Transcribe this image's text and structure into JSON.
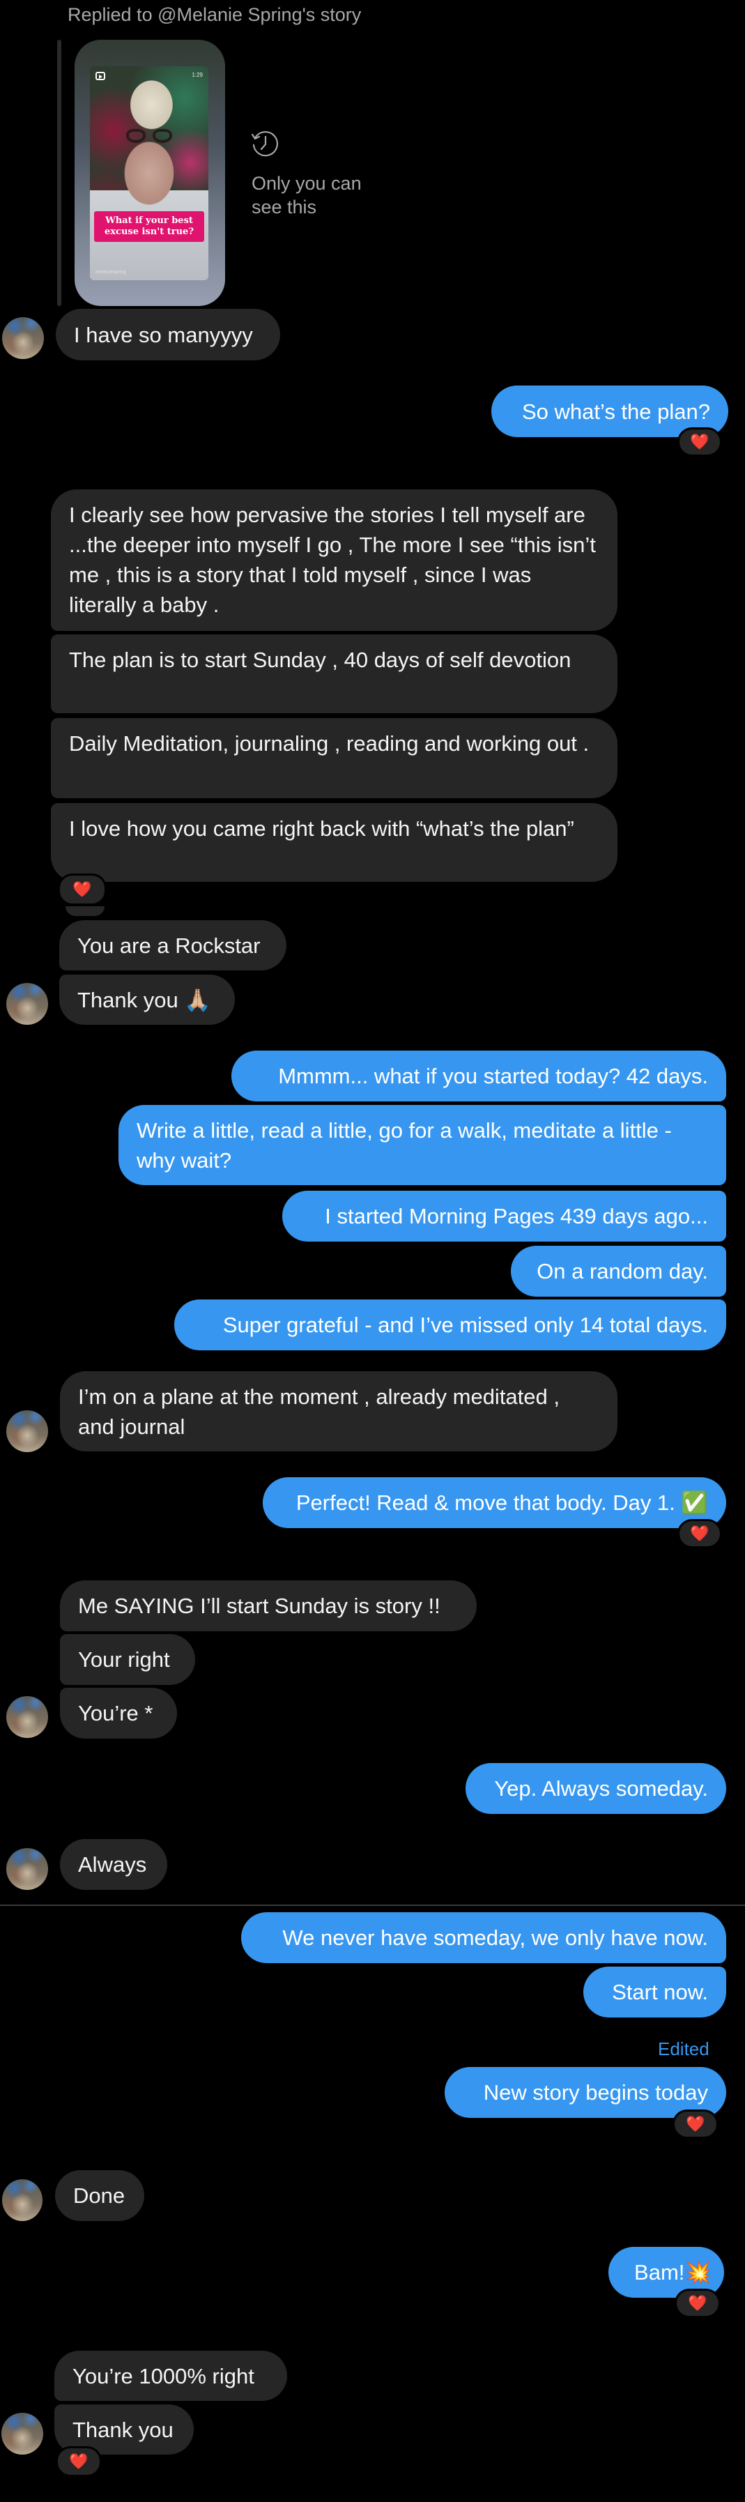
{
  "reply_header": {
    "label": "Replied to @Melanie Spring's story",
    "story": {
      "caption": "What if your best excuse isn't true?",
      "duration": "1:29",
      "handle": "melaniespring",
      "media_type_icon": "reels-icon"
    },
    "visibility_icon": "history-clock-icon",
    "visibility_note": "Only you can see this"
  },
  "colors": {
    "sent_bubble": "#3797f0",
    "received_bubble": "#262626",
    "background": "#000000",
    "edited_label": "#3797f0"
  },
  "messages": [
    {
      "id": "m1",
      "from": "them",
      "text": "I have so manyyyy"
    },
    {
      "id": "m2",
      "from": "me",
      "text": "So what’s the plan?",
      "reaction": "❤️"
    },
    {
      "id": "m3",
      "from": "them",
      "text": "I clearly see how pervasive the stories I tell myself are ...the deeper into myself I go , The more I see “this isn’t me , this is a story that I told myself , since I was literally a baby ."
    },
    {
      "id": "m4",
      "from": "them",
      "text": "The plan is to start Sunday , 40 days of self devotion"
    },
    {
      "id": "m5",
      "from": "them",
      "text": "Daily Meditation, journaling , reading and working out ."
    },
    {
      "id": "m6",
      "from": "them",
      "text": "I love how you came right back with “what’s the plan”",
      "reaction": "❤️"
    },
    {
      "id": "m7",
      "from": "them",
      "text": "You are a Rockstar"
    },
    {
      "id": "m8",
      "from": "them",
      "text": "Thank you 🙏🏼"
    },
    {
      "id": "m9",
      "from": "me",
      "text": "Mmmm... what if you started today? 42 days."
    },
    {
      "id": "m10",
      "from": "me",
      "text": "Write a little, read a little, go for a walk, meditate a little - why wait?"
    },
    {
      "id": "m11",
      "from": "me",
      "text": "I started Morning Pages 439 days ago..."
    },
    {
      "id": "m12",
      "from": "me",
      "text": "On a random day."
    },
    {
      "id": "m13",
      "from": "me",
      "text": "Super grateful - and I’ve missed only 14 total days."
    },
    {
      "id": "m14",
      "from": "them",
      "text": "I’m on a plane at the moment , already meditated , and journal"
    },
    {
      "id": "m15",
      "from": "me",
      "text": "Perfect! Read & move that body. Day 1. ✅",
      "reaction": "❤️"
    },
    {
      "id": "m16",
      "from": "them",
      "text": "Me SAYING I’ll start Sunday is story !!"
    },
    {
      "id": "m17",
      "from": "them",
      "text": "Your right"
    },
    {
      "id": "m18",
      "from": "them",
      "text": "You’re *"
    },
    {
      "id": "m19",
      "from": "me",
      "text": "Yep. Always someday."
    },
    {
      "id": "m20",
      "from": "them",
      "text": "Always"
    },
    {
      "id": "m21",
      "from": "me",
      "text": "We never have someday, we only have now."
    },
    {
      "id": "m22",
      "from": "me",
      "text": "Start now."
    },
    {
      "id": "m23",
      "from": "me",
      "text": "New story begins today",
      "edited_label": "Edited",
      "reaction": "❤️"
    },
    {
      "id": "m24",
      "from": "them",
      "text": "Done"
    },
    {
      "id": "m25",
      "from": "me",
      "text": "Bam!💥",
      "reaction": "❤️"
    },
    {
      "id": "m26",
      "from": "them",
      "text": "You’re 1000% right"
    },
    {
      "id": "m27",
      "from": "them",
      "text": "Thank you",
      "reaction": "❤️"
    }
  ]
}
